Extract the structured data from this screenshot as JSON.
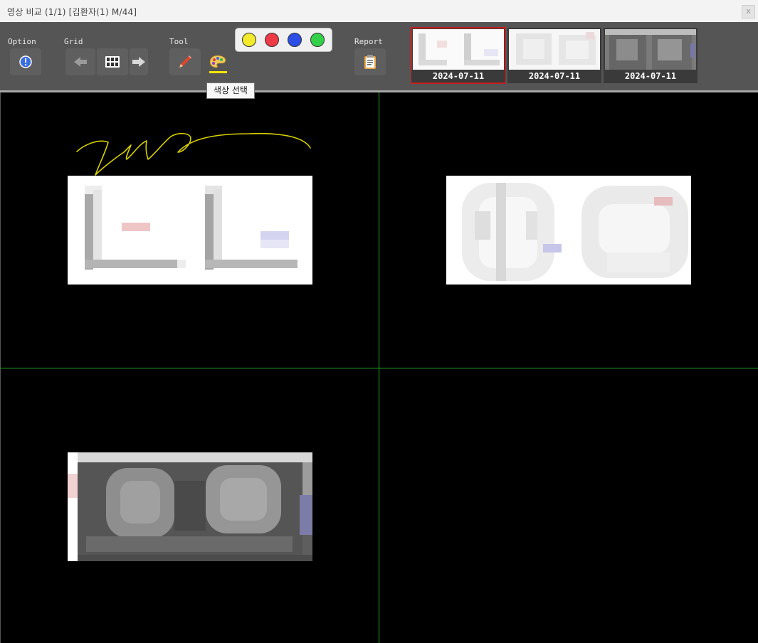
{
  "window": {
    "title": "영상 비교  (1/1)  [김환자(1) M/44]",
    "close_label": "x"
  },
  "toolbar": {
    "option_label": "Option",
    "grid_label": "Grid",
    "tool_label": "Tool",
    "report_label": "Report",
    "tooltip": "색상 선택",
    "icons": [
      "info-icon",
      "arrow-left-icon",
      "grid-layout-icon",
      "arrow-right-icon",
      "pencil-icon",
      "palette-icon",
      "clipboard-icon"
    ],
    "colors": [
      "#f2ea2a",
      "#ee3b45",
      "#2a4ee6",
      "#33d04a"
    ]
  },
  "thumbnails": [
    {
      "date": "2024-07-11",
      "selected": true
    },
    {
      "date": "2024-07-11",
      "selected": false
    },
    {
      "date": "2024-07-11",
      "selected": false
    }
  ],
  "viewer": {
    "grid_color": "#1faa2a",
    "annotation_color": "#d8d000"
  }
}
